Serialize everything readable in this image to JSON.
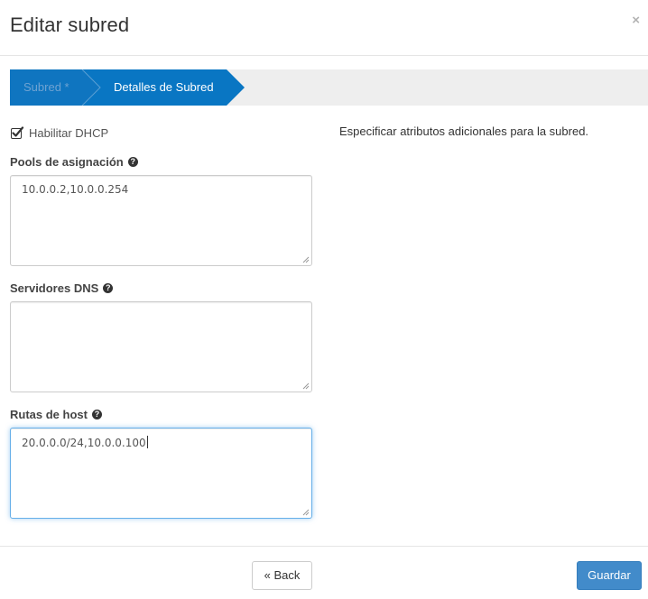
{
  "modal": {
    "title": "Editar subred",
    "close_label": "×"
  },
  "wizard": {
    "steps": [
      {
        "label": "Subred *",
        "state": "inactive"
      },
      {
        "label": "Detalles de Subred",
        "state": "active"
      }
    ],
    "colors": {
      "active": "#0976c3",
      "inactive_bg": "#0f75c0",
      "bar_bg": "#eeeeee"
    }
  },
  "form": {
    "dhcp_checkbox": {
      "label": "Habilitar DHCP",
      "checked": true
    },
    "allocation_pools": {
      "label": "Pools de asignación",
      "help_icon": "question-circle-icon",
      "value": "10.0.0.2,10.0.0.254"
    },
    "dns_servers": {
      "label": "Servidores DNS",
      "help_icon": "question-circle-icon",
      "value": ""
    },
    "host_routes": {
      "label": "Rutas de host",
      "help_icon": "question-circle-icon",
      "value": "20.0.0.0/24,10.0.0.100",
      "focused": true
    }
  },
  "help_text": "Especificar atributos adicionales para la subred.",
  "footer": {
    "back_label": "« Back",
    "save_label": "Guardar"
  }
}
